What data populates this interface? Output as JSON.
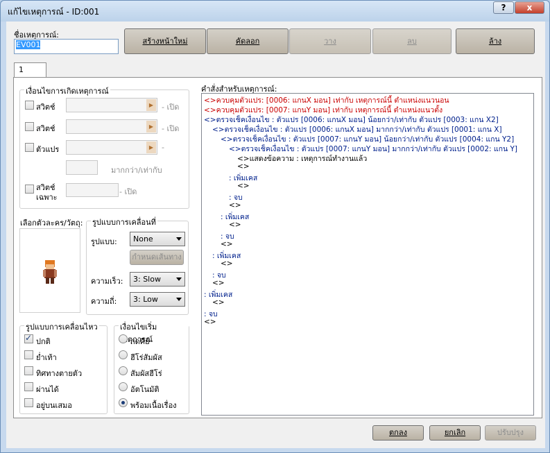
{
  "window": {
    "title": "แก้ไขเหตุการณ์ - ID:001",
    "help_label": "?",
    "close_label": "x"
  },
  "event_name": {
    "label": "ชื่อเหตุการณ์:",
    "value": "EV001"
  },
  "toolbar": {
    "new_page": "สร้างหน้าใหม่",
    "copy": "คัดลอก",
    "paste": "วาง",
    "delete": "ลบ",
    "clear": "ล้าง"
  },
  "tab": {
    "label": "1"
  },
  "conditions": {
    "title": "เงื่อนไขการเกิดเหตุการณ์",
    "switch1": {
      "label": "สวิตช์",
      "suffix": "- เปิด"
    },
    "switch2": {
      "label": "สวิตช์",
      "suffix": "- เปิด"
    },
    "variable": {
      "label": "ตัวแปร",
      "suffix": "-",
      "compare": "มากกว่า/เท่ากับ"
    },
    "self_switch": {
      "label_line1": "สวิตช์",
      "label_line2": "เฉพาะ",
      "suffix": "- เปิด"
    }
  },
  "graphic": {
    "label": "เลือกตัวละคร/วัตถุ:"
  },
  "movement": {
    "title": "รูปแบบการเคลื่อนที่",
    "type_label": "รูปแบบ:",
    "type_value": "None",
    "route_button": "กำหนดเส้นทาง",
    "speed_label": "ความเร็ว:",
    "speed_value": "3: Slow",
    "freq_label": "ความถี่:",
    "freq_value": "3: Low"
  },
  "options": {
    "title": "รูปแบบการเคลื่อนไหว",
    "items": [
      {
        "label": "ปกติ",
        "checked": true
      },
      {
        "label": "ย่ำเท้า",
        "checked": false
      },
      {
        "label": "ทิศทางตายตัว",
        "checked": false
      },
      {
        "label": "ผ่านได้",
        "checked": false
      },
      {
        "label": "อยู่บนเสมอ",
        "checked": false
      }
    ]
  },
  "trigger": {
    "title": "เงื่อนไขเริ่มเหตุการณ์",
    "items": [
      {
        "label": "กดคีย์",
        "selected": false
      },
      {
        "label": "ฮีโร่สัมผัส",
        "selected": false
      },
      {
        "label": "สัมผัสฮีโร่",
        "selected": false
      },
      {
        "label": "อัตโนมัติ",
        "selected": false
      },
      {
        "label": "พร้อมเนื้อเรื่อง",
        "selected": true
      }
    ]
  },
  "commands": {
    "label": "คำสั่งสำหรับเหตุการณ์:",
    "lines": [
      {
        "text": "<>ควบคุมตัวแปร: [0006: แกนX มอน] เท่ากับ เหตุการณ์นี้ ตำแหน่งแนวนอน",
        "color": "red",
        "indent": 0
      },
      {
        "text": "<>ควบคุมตัวแปร: [0007: แกนY มอน] เท่ากับ เหตุการณ์นี้ ตำแหน่งแนวตั้ง",
        "color": "red",
        "indent": 0
      },
      {
        "text": "<>ตรวจเช็คเงื่อนไข : ตัวแปร [0006: แกนX มอน] น้อยกว่า/เท่ากับ ตัวแปร [0003: แกน X2]",
        "color": "blue",
        "indent": 0
      },
      {
        "text": "<>ตรวจเช็คเงื่อนไข : ตัวแปร [0006: แกนX มอน] มากกว่า/เท่ากับ ตัวแปร [0001: แกน X]",
        "color": "blue",
        "indent": 1
      },
      {
        "text": "<>ตรวจเช็คเงื่อนไข : ตัวแปร [0007: แกนY มอน] น้อยกว่า/เท่ากับ ตัวแปร [0004: แกน Y2]",
        "color": "blue",
        "indent": 2
      },
      {
        "text": "<>ตรวจเช็คเงื่อนไข : ตัวแปร [0007: แกนY มอน] มากกว่า/เท่ากับ ตัวแปร [0002: แกน Y]",
        "color": "blue",
        "indent": 3
      },
      {
        "text": "<>แสดงข้อความ : เหตุการณ์ทำงานแล้ว",
        "color": "black",
        "indent": 4
      },
      {
        "text": "<>",
        "color": "black",
        "indent": 4
      },
      {
        "text": ": เพิ่มเคส",
        "color": "blue",
        "indent": 3
      },
      {
        "text": "<>",
        "color": "black",
        "indent": 4
      },
      {
        "text": ": จบ",
        "color": "blue",
        "indent": 3
      },
      {
        "text": "<>",
        "color": "black",
        "indent": 3
      },
      {
        "text": ": เพิ่มเคส",
        "color": "blue",
        "indent": 2
      },
      {
        "text": "<>",
        "color": "black",
        "indent": 3
      },
      {
        "text": ": จบ",
        "color": "blue",
        "indent": 2
      },
      {
        "text": "<>",
        "color": "black",
        "indent": 2
      },
      {
        "text": ": เพิ่มเคส",
        "color": "blue",
        "indent": 1
      },
      {
        "text": "<>",
        "color": "black",
        "indent": 2
      },
      {
        "text": ": จบ",
        "color": "blue",
        "indent": 1
      },
      {
        "text": "<>",
        "color": "black",
        "indent": 1
      },
      {
        "text": ": เพิ่มเคส",
        "color": "blue",
        "indent": 0
      },
      {
        "text": "<>",
        "color": "black",
        "indent": 1
      },
      {
        "text": ": จบ",
        "color": "blue",
        "indent": 0
      },
      {
        "text": "<>",
        "color": "black",
        "indent": 0
      }
    ]
  },
  "footer": {
    "ok": "ตกลง",
    "cancel": "ยกเลิก",
    "apply": "ปรับปรุง"
  }
}
